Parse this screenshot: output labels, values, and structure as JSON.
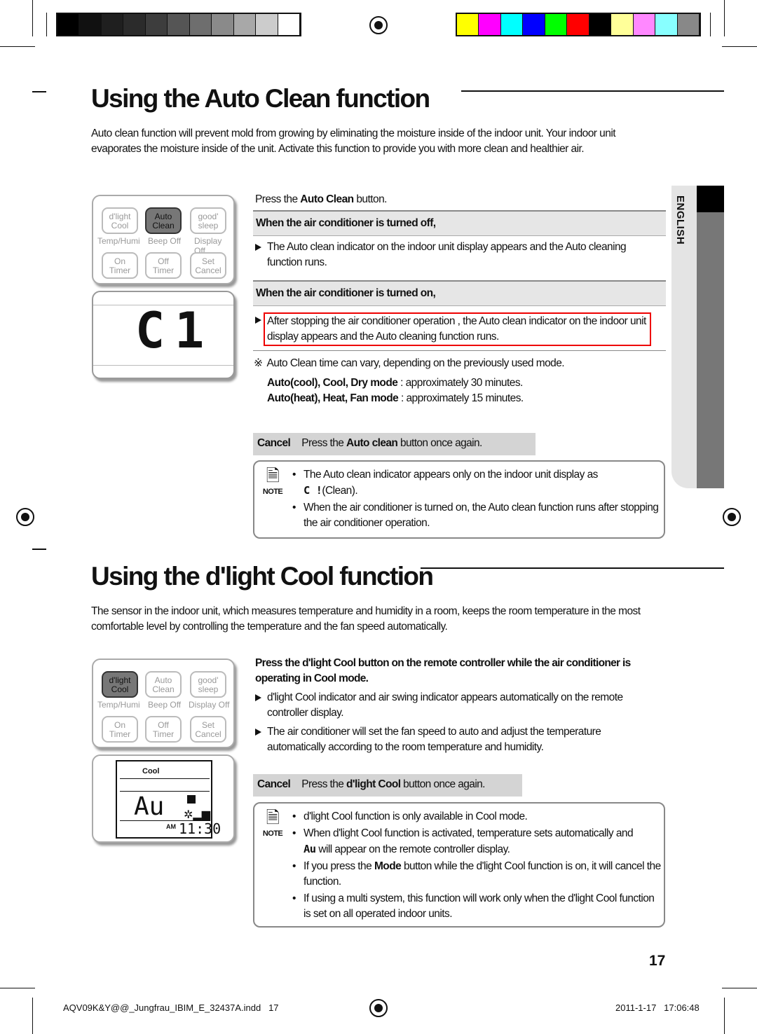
{
  "print_marks": {
    "grayscale": [
      "#000000",
      "#111111",
      "#1f1f1f",
      "#2b2b2b",
      "#3d3d3d",
      "#555555",
      "#6e6e6e",
      "#8a8a8a",
      "#a8a8a8",
      "#cccccc",
      "#ffffff"
    ],
    "colors": [
      "#ffff00",
      "#ff00ff",
      "#00ffff",
      "#0000ff",
      "#00ff00",
      "#ff0000",
      "#000000",
      "#ffff99",
      "#ff88ff",
      "#88ffff",
      "#888888"
    ]
  },
  "side_tab": {
    "label": "ENGLISH"
  },
  "section1": {
    "title": "Using the Auto Clean function",
    "intro": "Auto clean function will prevent mold from growing by eliminating the moisture inside of the indoor unit. Your indoor unit evaporates the moisture inside of the unit. Activate this function to provide you with more clean and healthier air.",
    "press": {
      "pre": "Press the ",
      "bold": "Auto Clean",
      "post": " button."
    },
    "off_header": "When the air conditioner is turned off,",
    "off_text": "The Auto clean indicator on the indoor unit display appears and the Auto cleaning function runs.",
    "on_header": "When the air conditioner is turned on,",
    "on_text": "After stopping the air conditioner operation , the Auto clean indicator on the indoor unit display appears and the Auto cleaning function runs.",
    "note_symbol": "※",
    "time_note": "Auto Clean time can vary, depending on the previously used mode.",
    "time1": {
      "bold": "Auto(cool), Cool, Dry mode",
      "rest": " : approximately 30 minutes."
    },
    "time2": {
      "bold": "Auto(heat), Heat, Fan mode",
      "rest": " : approximately 15 minutes."
    },
    "cancel": {
      "label": "Cancel",
      "pre": "Press the ",
      "bold": "Auto clean",
      "post": " button once again."
    },
    "note_label": "NOTE",
    "notes": [
      "The Auto clean indicator appears only on the indoor unit display as",
      "(Clean).",
      "When the air conditioner is turned on, the Auto clean function runs after stopping the air conditioner operation."
    ],
    "remote": {
      "buttons": [
        "d'light",
        "Cool",
        "Auto",
        "Clean",
        "good'",
        "sleep",
        "On",
        "Timer",
        "Off",
        "Timer",
        "Set",
        "Cancel"
      ],
      "labels": [
        "Temp/Humi",
        "Beep Off",
        "Display Off"
      ],
      "display": "C1"
    }
  },
  "section2": {
    "title": "Using the d'light Cool function",
    "intro": "The sensor in the indoor unit, which measures temperature and humidity in a room, keeps the room temperature in the most comfortable level by controlling the temperature and the fan speed automatically.",
    "press": "Press the d'light Cool button on the remote controller while the air conditioner is operating in Cool mode.",
    "bullets": [
      "d'light Cool indicator and air swing indicator appears automatically on the remote controller display.",
      "The air conditioner will set the fan speed to auto and adjust the temperature automatically according to the room temperature and humidity."
    ],
    "cancel": {
      "label": "Cancel",
      "pre": "Press the ",
      "bold": "d'light Cool",
      "post": " button once again."
    },
    "note_label": "NOTE",
    "notes": {
      "n1": "d'light Cool function is only available in Cool mode.",
      "n2a": "When d'light Cool function is activated, temperature sets automatically and",
      "n2b": "will appear on the remote controller display.",
      "n3pre": "If you press the ",
      "n3bold": "Mode",
      "n3post": " button while the d'light Cool function is on, it will cancel the function.",
      "n4": "If using a multi system, this function will work only when the d'light Cool function is set on all operated indoor units."
    },
    "remote": {
      "mode": "Cool",
      "display": "Au",
      "am": "AM",
      "time": "11:30"
    }
  },
  "page_number": "17",
  "footer": {
    "file": "AQV09K&Y@@_Jungfrau_IBIM_E_32437A.indd   17",
    "date": "2011-1-17   17:06:48"
  }
}
